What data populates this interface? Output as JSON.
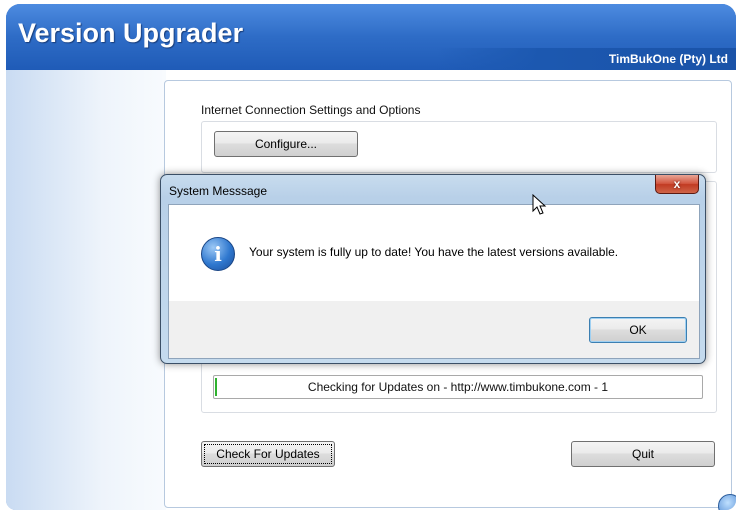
{
  "app": {
    "title": "Version Upgrader",
    "company": "TimBukOne (Pty) Ltd"
  },
  "connection": {
    "label": "Internet Connection Settings and Options",
    "configure_label": "Configure..."
  },
  "status": {
    "text": "Checking for Updates on - http://www.timbukone.com - 1",
    "progress_color": "#2fb22f"
  },
  "buttons": {
    "check_label": "Check For Updates",
    "quit_label": "Quit"
  },
  "dialog": {
    "title": "System Messsage",
    "close_label": "x",
    "message": "Your system is fully up to date! You have the latest versions available.",
    "ok_label": "OK",
    "icon": "info-icon"
  },
  "colors": {
    "header_blue": "#2e6cc6",
    "close_red": "#c13a22"
  }
}
